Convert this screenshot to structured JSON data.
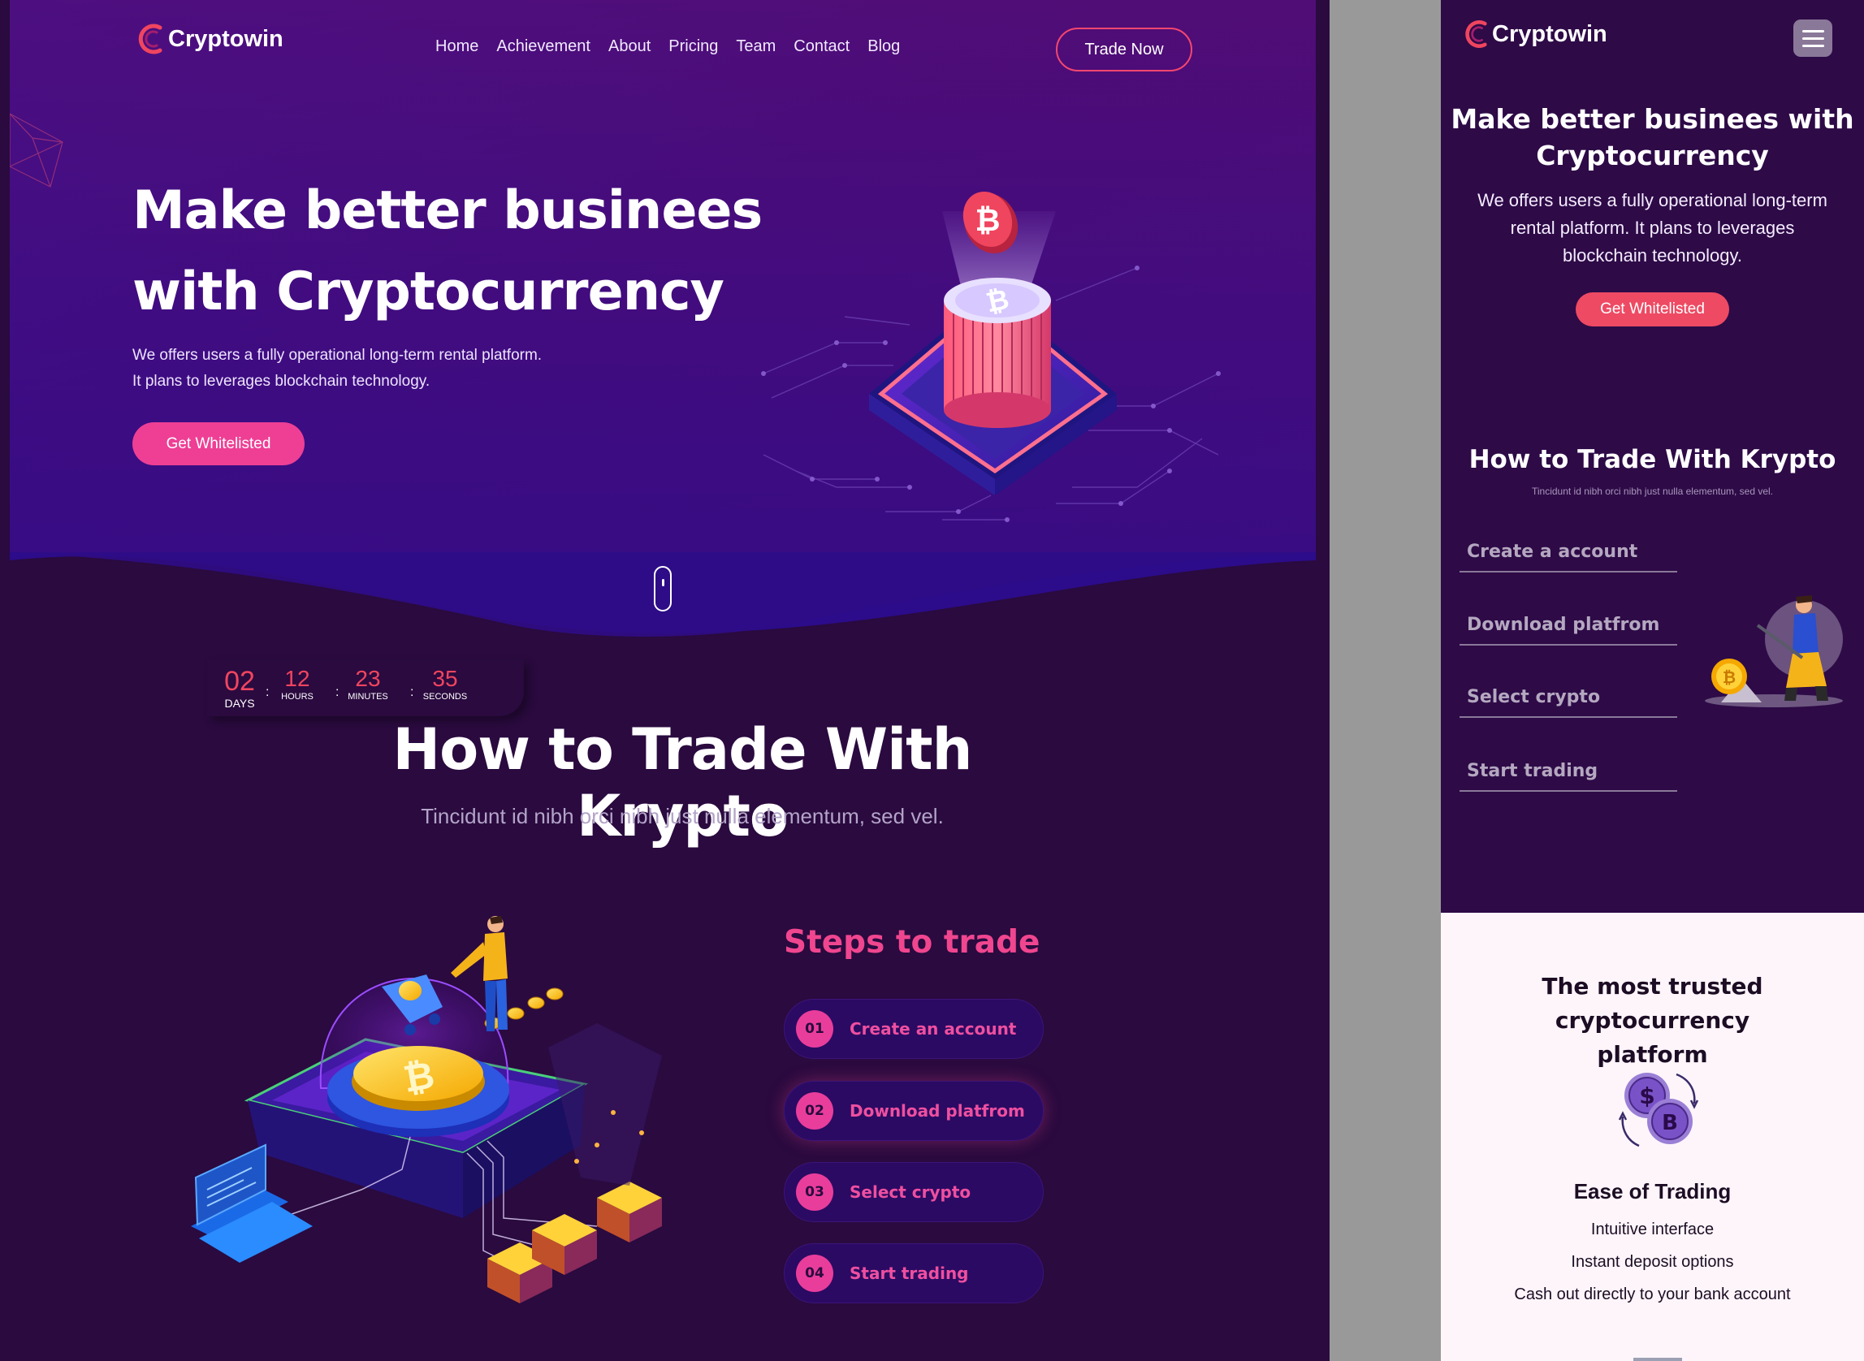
{
  "brand": {
    "name": "Cryptowin",
    "accent": "#ee3f95",
    "secondary_accent": "#f0455f",
    "dark_bg": "#2a0a3f",
    "hero_gradient": [
      "#5a0f7a",
      "#2c0c8a"
    ]
  },
  "desktop": {
    "nav": {
      "items": [
        "Home",
        "Achievement",
        "About",
        "Pricing",
        "Team",
        "Contact",
        "Blog"
      ],
      "cta": "Trade Now"
    },
    "hero": {
      "title_line1": "Make better businees",
      "title_line2": "with Cryptocurrency",
      "desc_line1": "We offers users a fully operational long-term rental platform.",
      "desc_line2": "It plans to leverages blockchain technology.",
      "cta": "Get Whitelisted",
      "art_icon": "bitcoin-stack-icon"
    },
    "countdown": {
      "days": "02",
      "days_label": "DAYS",
      "hours": "12",
      "hours_label": "HOURS",
      "minutes": "23",
      "minutes_label": "MINUTES",
      "seconds": "35",
      "seconds_label": "SECONDS",
      "sep": ":"
    },
    "how": {
      "title": "How to Trade With Krypto",
      "subtitle": "Tincidunt id nibh orci nibh just nulla elementum, sed vel."
    },
    "steps": {
      "title": "Steps to trade",
      "items": [
        {
          "num": "01",
          "label": "Create an account"
        },
        {
          "num": "02",
          "label": "Download platfrom"
        },
        {
          "num": "03",
          "label": "Select crypto"
        },
        {
          "num": "04",
          "label": "Start trading"
        }
      ]
    }
  },
  "mobile": {
    "brand": "Cryptowin",
    "menu_icon": "hamburger-menu-icon",
    "hero": {
      "title_line1": "Make better businees with",
      "title_line2": "Cryptocurrency",
      "desc_line1": "We offers users a fully operational long-term",
      "desc_line2": "rental platform. It plans to leverages",
      "desc_line3": "blockchain technology.",
      "cta": "Get Whitelisted"
    },
    "how": {
      "title": "How to Trade With Krypto",
      "subtitle": "Tincidunt id nibh orci nibh just nulla elementum, sed vel."
    },
    "steps": [
      "Create a account",
      "Download platfrom",
      "Select crypto",
      "Start trading"
    ],
    "trusted": {
      "title_line1": "The most trusted cryptocurrency",
      "title_line2": "platform",
      "feature_icon": "crypto-exchange-icon",
      "feature_title": "Ease of Trading",
      "feature_items": [
        "Intuitive interface",
        "Instant deposit options",
        "Cash out directly to your bank account"
      ]
    }
  }
}
